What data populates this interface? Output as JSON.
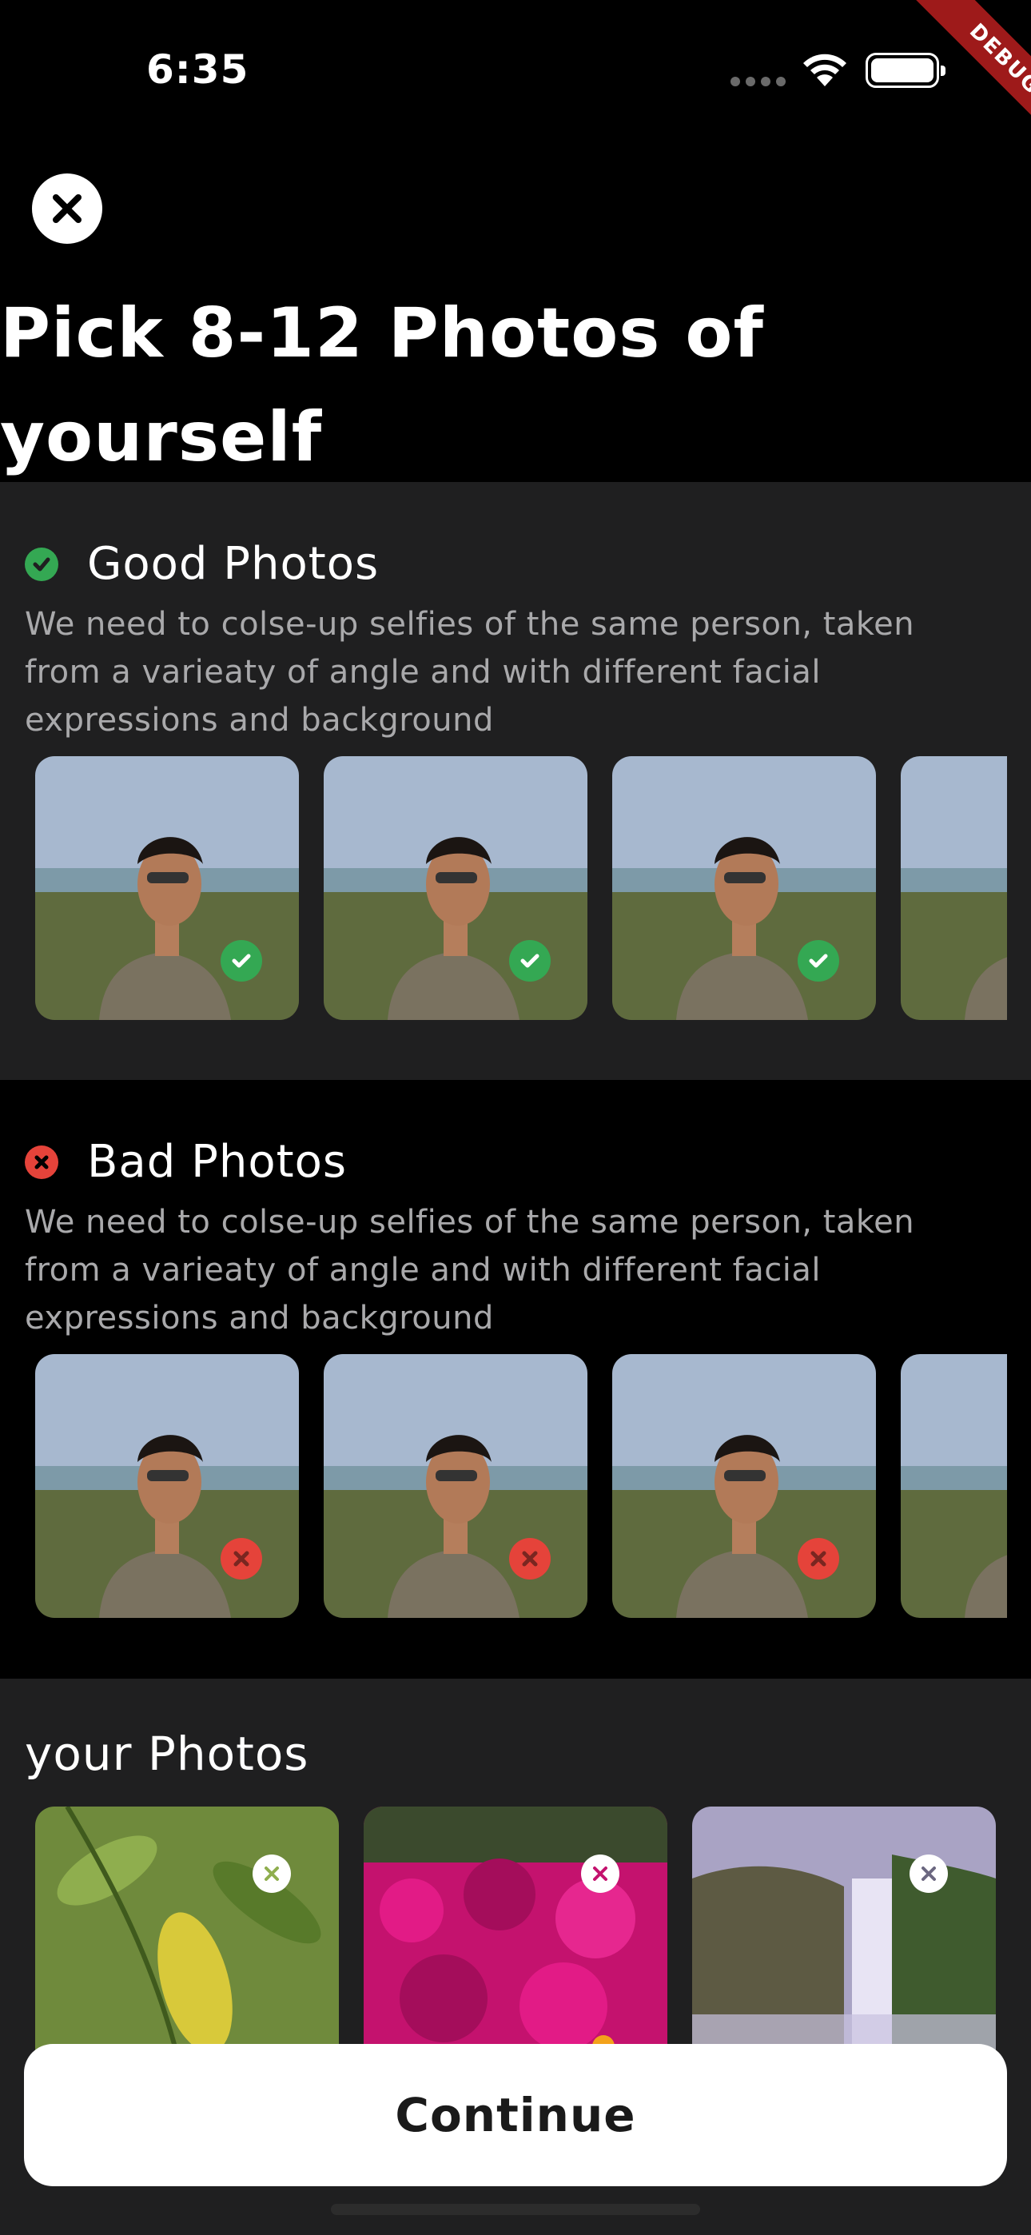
{
  "status_bar": {
    "time": "6:35",
    "icons": [
      "signal-icon",
      "wifi-icon",
      "battery-icon"
    ]
  },
  "debug_banner": "DEBUG",
  "header": {
    "close_icon": "close-icon",
    "title": "Pick 8-12 Photos of yourself"
  },
  "good_photos": {
    "title": "Good Photos",
    "description": "We need to colse-up selfies of the same person, taken from a varieaty of angle and with different facial expressions and background",
    "icon": "check-circle-icon",
    "color": "#34a853",
    "photos": [
      {
        "name": "good-photo-1",
        "mark_icon": "check-icon"
      },
      {
        "name": "good-photo-2",
        "mark_icon": "check-icon"
      },
      {
        "name": "good-photo-3",
        "mark_icon": "check-icon"
      },
      {
        "name": "good-photo-4",
        "mark_icon": "check-icon"
      }
    ]
  },
  "bad_photos": {
    "title": "Bad Photos",
    "description": "We need to colse-up selfies of the same person, taken from a varieaty of angle and with different facial expressions and background",
    "icon": "x-circle-icon",
    "color": "#e5433a",
    "photos": [
      {
        "name": "bad-photo-1",
        "mark_icon": "x-icon"
      },
      {
        "name": "bad-photo-2",
        "mark_icon": "x-icon"
      },
      {
        "name": "bad-photo-3",
        "mark_icon": "x-icon"
      },
      {
        "name": "bad-photo-4",
        "mark_icon": "x-icon"
      }
    ]
  },
  "your_photos": {
    "title": "your Photos",
    "photos": [
      {
        "name": "leaf-photo",
        "remove_icon": "remove-icon"
      },
      {
        "name": "flowers-photo",
        "remove_icon": "remove-icon"
      },
      {
        "name": "waterfall-photo",
        "remove_icon": "remove-icon"
      }
    ]
  },
  "continue_button": "Continue"
}
